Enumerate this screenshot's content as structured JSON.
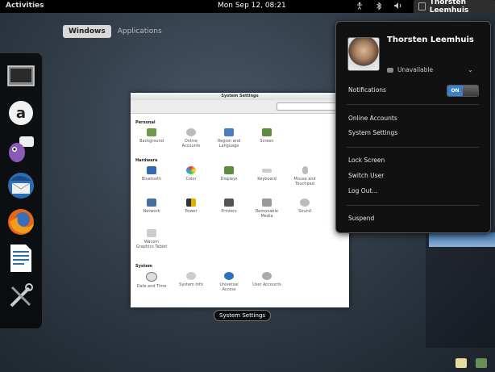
{
  "topbar": {
    "activities": "Activities",
    "clock": "Mon Sep 12, 08:21",
    "user_name": "Thorsten Leemhuis",
    "status_icons": [
      "accessibility-icon",
      "bluetooth-icon",
      "volume-icon",
      "network-icon"
    ]
  },
  "overview": {
    "tabs": [
      "Windows",
      "Applications"
    ],
    "active_tab": "Windows",
    "window_caption": "System Settings"
  },
  "dash": {
    "apps": [
      "monitor-app-icon",
      "empathy-app-icon",
      "pidgin-app-icon",
      "thunderbird-app-icon",
      "firefox-app-icon",
      "writer-app-icon",
      "system-tools-app-icon"
    ]
  },
  "settings_window": {
    "title": "System Settings",
    "sections": [
      {
        "title": "Personal",
        "items": [
          "Background",
          "Online Accounts",
          "Region and Language",
          "Screen"
        ]
      },
      {
        "title": "Hardware",
        "items": [
          "Bluetooth",
          "Color",
          "Displays",
          "Keyboard",
          "Mouse and Touchpad",
          "Network",
          "Power",
          "Printers",
          "Removable Media",
          "Sound",
          "Wacom Graphics Tablet"
        ]
      },
      {
        "title": "System",
        "items": [
          "Date and Time",
          "System Info",
          "Universal Access",
          "User Accounts"
        ]
      }
    ]
  },
  "user_menu": {
    "name": "Thorsten Leemhuis",
    "status": "Unavailable",
    "notifications_label": "Notifications",
    "notifications_state": "ON",
    "online_accounts": "Online Accounts",
    "system_settings": "System Settings",
    "lock_screen": "Lock Screen",
    "switch_user": "Switch User",
    "log_out": "Log Out...",
    "suspend": "Suspend"
  },
  "colors": {
    "toggle_on": "#3d80c9",
    "topbar": "#000000",
    "menu_bg": "#111111"
  }
}
